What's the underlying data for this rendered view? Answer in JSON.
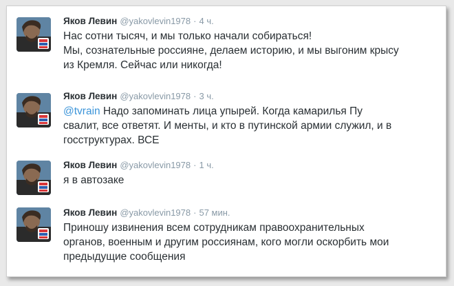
{
  "colors": {
    "link": "#3b94d9",
    "text": "#292f33",
    "meta": "#8899a6"
  },
  "tweets": [
    {
      "name": "Яков Левин",
      "handle": "@yakovlevin1978",
      "dot": "·",
      "time": "4 ч.",
      "lines": [
        "Нас сотни тысяч, и мы только начали собираться!",
        "Мы, сознательные россияне, делаем историю, и мы выгоним крысу",
        "из Кремля. Сейчас или никогда!"
      ]
    },
    {
      "name": "Яков Левин",
      "handle": "@yakovlevin1978",
      "dot": "·",
      "time": "3 ч.",
      "mention": "@tvrain",
      "lines": [
        " Надо запоминать лица упырей. Когда камарилья Пу",
        "свалит, все ответят. И менты, и кто в путинской армии служил, и в",
        "госструктурах. ВСЕ"
      ]
    },
    {
      "name": "Яков Левин",
      "handle": "@yakovlevin1978",
      "dot": "·",
      "time": "1 ч.",
      "lines": [
        "я в автозаке"
      ]
    },
    {
      "name": "Яков Левин",
      "handle": "@yakovlevin1978",
      "dot": "·",
      "time": "57 мин.",
      "lines": [
        "Приношу извинения всем сотрудникам правоохранительных",
        "органов, военным и другим россиянам, кого могли оскорбить мои",
        "предыдущие сообщения"
      ]
    }
  ]
}
